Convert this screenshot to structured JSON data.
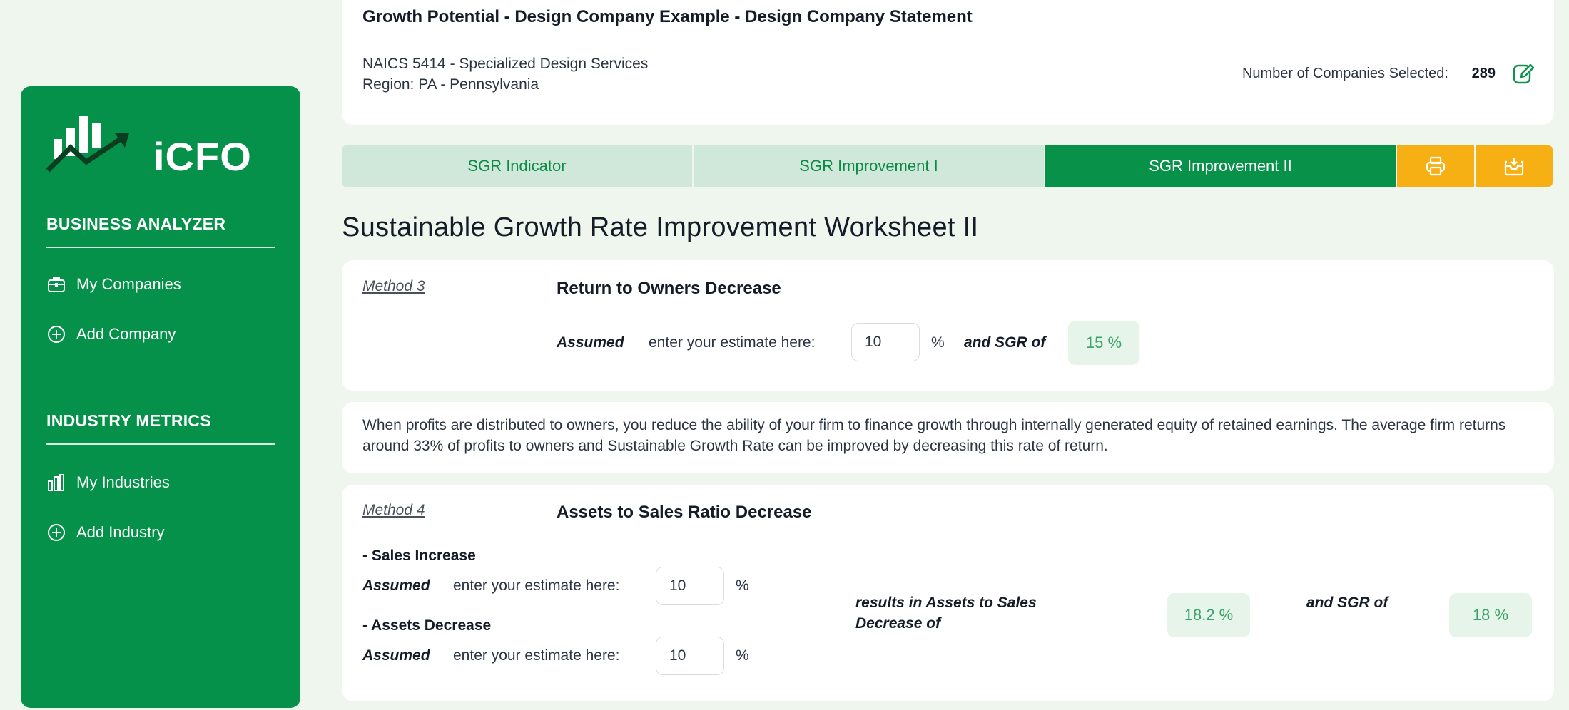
{
  "sidebar": {
    "logo_text": "iCFO",
    "business_analyzer": "BUSINESS ANALYZER",
    "my_companies": "My Companies",
    "add_company": "Add Company",
    "industry_metrics": "INDUSTRY METRICS",
    "my_industries": "My Industries",
    "add_industry": "Add Industry"
  },
  "header": {
    "title": "Growth Potential - Design Company Example - Design Company Statement",
    "naics": "NAICS 5414 - Specialized Design Services",
    "region": "Region: PA - Pennsylvania",
    "count_label": "Number of Companies Selected:",
    "count_value": "289"
  },
  "tabs": {
    "t1": "SGR Indicator",
    "t2": "SGR Improvement I",
    "t3": "SGR Improvement II"
  },
  "worksheet_title": "Sustainable Growth Rate Improvement Worksheet II",
  "method3": {
    "label": "Method 3",
    "title": "Return to Owners Decrease",
    "assumed": "Assumed",
    "enter": "enter your estimate here:",
    "input_value": "10",
    "pct": "%",
    "and_sgr": "and SGR of",
    "sgr_result": "15 %"
  },
  "description": "When profits are distributed to owners, you reduce the ability of your firm to finance growth through internally generated equity of retained earnings. The average firm returns around 33% of profits to owners and Sustainable Growth Rate can be improved by decreasing this rate of return.",
  "method4": {
    "label": "Method 4",
    "title": "Assets to Sales Ratio Decrease",
    "sales_head": "- Sales Increase",
    "assets_head": "- Assets Decrease",
    "assumed": "Assumed",
    "enter": "enter your estimate here:",
    "sales_value": "10",
    "assets_value": "10",
    "pct": "%",
    "results_line1": "results in Assets to Sales",
    "results_line2": "Decrease of",
    "ratio_result": "18.2 %",
    "and_sgr": "and SGR of",
    "sgr_result": "18 %"
  },
  "colors": {
    "primary": "#079149",
    "accent": "#f7b014",
    "tab_inactive": "#cfe8da",
    "background": "#eef6ee"
  },
  "icons": [
    "briefcase-icon",
    "plus-circle-icon",
    "bar-chart-icon",
    "edit-icon",
    "print-icon",
    "download-icon"
  ]
}
